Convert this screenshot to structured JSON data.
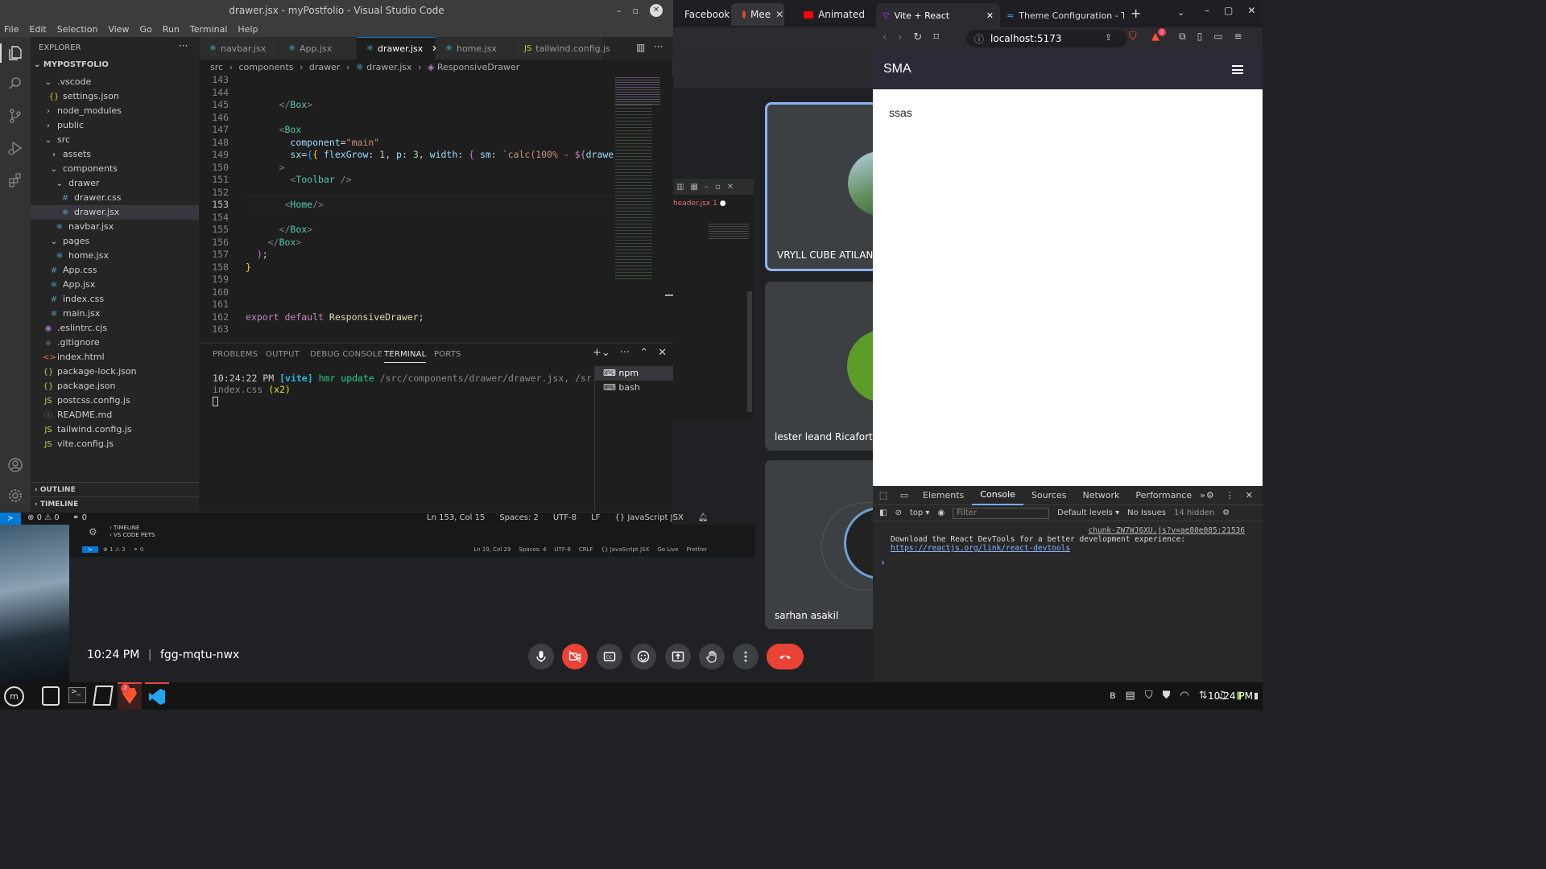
{
  "meet": {
    "top_tabs": [
      "Facebook",
      "Mee",
      "Animated"
    ],
    "participants": [
      "VRYLL CUBE ATILANO",
      "lester leand Ricafort",
      "sarhan asakil"
    ],
    "time": "10:24 PM",
    "meeting_code": "fgg-mqtu-nwx",
    "second_vscode": {
      "tab_label": "header.jsx 1",
      "sidebar_items": [
        "TIMELINE",
        "VS CODE PETS"
      ],
      "status_items": [
        "⊗ 1 ⚠ 3",
        "⚭ 0",
        "Ln 19, Col 29",
        "Spaces: 4",
        "UTF-8",
        "CRLF",
        "{} JavaScript JSX",
        "Go Live",
        "Prettier"
      ]
    }
  },
  "vscode": {
    "title": "drawer.jsx - myPostfolio - Visual Studio Code",
    "menu": [
      "File",
      "Edit",
      "Selection",
      "View",
      "Go",
      "Run",
      "Terminal",
      "Help"
    ],
    "explorer_title": "EXPLORER",
    "project": "MYPOSTFOLIO",
    "tree": [
      {
        "label": ".vscode",
        "kind": "folder-open",
        "depth": 1
      },
      {
        "label": "settings.json",
        "kind": "json",
        "depth": 2
      },
      {
        "label": "node_modules",
        "kind": "folder",
        "depth": 1
      },
      {
        "label": "public",
        "kind": "folder",
        "depth": 1
      },
      {
        "label": "src",
        "kind": "folder-open",
        "depth": 1
      },
      {
        "label": "assets",
        "kind": "folder",
        "depth": 2
      },
      {
        "label": "components",
        "kind": "folder-open",
        "depth": 2
      },
      {
        "label": "drawer",
        "kind": "folder-open",
        "depth": 3
      },
      {
        "label": "drawer.css",
        "kind": "css",
        "depth": 4
      },
      {
        "label": "drawer.jsx",
        "kind": "react",
        "depth": 4,
        "selected": true
      },
      {
        "label": "navbar.jsx",
        "kind": "react",
        "depth": 3
      },
      {
        "label": "pages",
        "kind": "folder-open",
        "depth": 2
      },
      {
        "label": "home.jsx",
        "kind": "react",
        "depth": 3
      },
      {
        "label": "App.css",
        "kind": "css",
        "depth": 2
      },
      {
        "label": "App.jsx",
        "kind": "react",
        "depth": 2
      },
      {
        "label": "index.css",
        "kind": "css",
        "depth": 2
      },
      {
        "label": "main.jsx",
        "kind": "react",
        "depth": 2
      },
      {
        "label": ".eslintrc.cjs",
        "kind": "eslint",
        "depth": 1
      },
      {
        "label": ".gitignore",
        "kind": "git",
        "depth": 1
      },
      {
        "label": "index.html",
        "kind": "html",
        "depth": 1
      },
      {
        "label": "package-lock.json",
        "kind": "json",
        "depth": 1
      },
      {
        "label": "package.json",
        "kind": "json",
        "depth": 1
      },
      {
        "label": "postcss.config.js",
        "kind": "js",
        "depth": 1
      },
      {
        "label": "README.md",
        "kind": "info",
        "depth": 1
      },
      {
        "label": "tailwind.config.js",
        "kind": "js",
        "depth": 1
      },
      {
        "label": "vite.config.js",
        "kind": "js",
        "depth": 1
      }
    ],
    "outline": "OUTLINE",
    "timeline": "TIMELINE",
    "tabs": [
      {
        "label": "navbar.jsx",
        "kind": "react"
      },
      {
        "label": "App.jsx",
        "kind": "react"
      },
      {
        "label": "drawer.jsx",
        "kind": "react",
        "active": true
      },
      {
        "label": "home.jsx",
        "kind": "react"
      },
      {
        "label": "tailwind.config.js",
        "kind": "js"
      }
    ],
    "breadcrumb": [
      "src",
      "components",
      "drawer",
      "drawer.jsx",
      "ResponsiveDrawer"
    ],
    "code_lines": [
      {
        "n": "143",
        "html": ""
      },
      {
        "n": "144",
        "html": ""
      },
      {
        "n": "145",
        "html": "      <span class='punc'>&lt;/</span><span class='tag'>Box</span><span class='punc'>&gt;</span>"
      },
      {
        "n": "146",
        "html": ""
      },
      {
        "n": "147",
        "html": "      <span class='punc'>&lt;</span><span class='tag'>Box</span>"
      },
      {
        "n": "148",
        "html": "        <span class='attr'>component</span><span class='plain'>=</span><span class='str'>\"main\"</span>"
      },
      {
        "n": "149",
        "html": "        <span class='attr'>sx</span><span class='plain'>=</span><span class='br3'>{</span><span class='br'>{</span><span class='plain'> </span><span class='attr'>flexGrow</span><span class='plain'>: </span><span class='num'>1</span><span class='plain'>, </span><span class='attr'>p</span><span class='plain'>: </span><span class='num'>3</span><span class='plain'>, </span><span class='attr'>width</span><span class='plain'>: </span><span class='br2'>{</span><span class='plain'> </span><span class='attr'>sm</span><span class='plain'>: </span><span class='str'>`calc(100% - </span><span class='kw'>${</span><span class='attr'>drawerWidth</span>"
      },
      {
        "n": "150",
        "html": "      <span class='punc'>&gt;</span>"
      },
      {
        "n": "151",
        "html": "        <span class='punc'>&lt;</span><span class='tag'>Toolbar</span><span class='punc'> /&gt;</span>"
      },
      {
        "n": "152",
        "html": ""
      },
      {
        "n": "153",
        "html": "       <span class='punc'>&lt;</span><span class='tag'>Home</span><span class='punc'>/&gt;</span>",
        "current": true
      },
      {
        "n": "154",
        "html": ""
      },
      {
        "n": "155",
        "html": "      <span class='punc'>&lt;/</span><span class='tag'>Box</span><span class='punc'>&gt;</span>"
      },
      {
        "n": "156",
        "html": "    <span class='punc'>&lt;/</span><span class='tag'>Box</span><span class='punc'>&gt;</span>"
      },
      {
        "n": "157",
        "html": "  <span class='br2'>)</span><span class='plain'>;</span>"
      },
      {
        "n": "158",
        "html": "<span class='br'>}</span>"
      },
      {
        "n": "159",
        "html": ""
      },
      {
        "n": "160",
        "html": ""
      },
      {
        "n": "161",
        "html": ""
      },
      {
        "n": "162",
        "html": "<span class='kw'>export</span><span class='plain'> </span><span class='kw'>default</span><span class='plain'> </span><span class='fn'>ResponsiveDrawer</span><span class='plain'>;</span>"
      },
      {
        "n": "163",
        "html": ""
      }
    ],
    "panel_tabs": [
      "PROBLEMS",
      "OUTPUT",
      "DEBUG CONSOLE",
      "TERMINAL",
      "PORTS"
    ],
    "terminal": {
      "time": "10:24:22 PM",
      "tag": "[vite]",
      "msg": "hmr update",
      "path": "/src/components/drawer/drawer.jsx, /src/ ,",
      "line2": "index.css",
      "count": "(x2)"
    },
    "terminals": [
      "npm",
      "bash"
    ],
    "status": {
      "errors": "0",
      "warnings": "0",
      "ports": "0",
      "position": "Ln 153, Col 15",
      "spaces": "Spaces: 2",
      "encoding": "UTF-8",
      "eol": "LF",
      "language": "JavaScript JSX"
    }
  },
  "browser": {
    "tabs": [
      {
        "label": "Vite + React",
        "active": true
      },
      {
        "label": "Theme Configuration - Ta"
      }
    ],
    "url": "localhost:5173",
    "shield_badge": "1",
    "app": {
      "title": "SMA",
      "content": "ssas"
    },
    "devtools": {
      "tabs": [
        "Elements",
        "Console",
        "Sources",
        "Network",
        "Performance"
      ],
      "active_tab": "Console",
      "context": "top",
      "filter_placeholder": "Filter",
      "levels": "Default levels",
      "issues": "No Issues",
      "hidden": "14 hidden",
      "source_link": "chunk-ZW7WJ6XU.js?v=ae80e085:21536",
      "message": "Download the React DevTools for a better development experience: ",
      "message_link": "https://reactjs.org/link/react-devtools"
    }
  },
  "taskbar": {
    "time": "10:24 PM",
    "brave_badge": "2"
  },
  "colors": {
    "vscode_accent": "#0078d4",
    "meet_end_call": "#ea4335",
    "app_bar": "#2d2a38",
    "tile_highlight": "#8ab4f8"
  }
}
